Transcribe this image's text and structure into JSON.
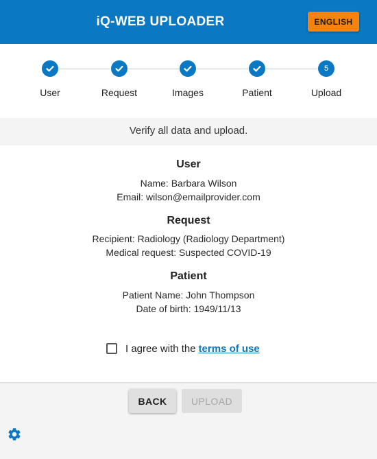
{
  "header": {
    "title": "iQ-WEB UPLOADER",
    "language_button": "ENGLISH"
  },
  "stepper": {
    "steps": [
      {
        "label": "User",
        "state": "completed"
      },
      {
        "label": "Request",
        "state": "completed"
      },
      {
        "label": "Images",
        "state": "completed"
      },
      {
        "label": "Patient",
        "state": "completed"
      },
      {
        "label": "Upload",
        "state": "active",
        "number": "5"
      }
    ]
  },
  "instruction": "Verify all data and upload.",
  "summary": {
    "user": {
      "title": "User",
      "name_line": "Name: Barbara Wilson",
      "email_line": "Email: wilson@emailprovider.com"
    },
    "request": {
      "title": "Request",
      "recipient_line": "Recipient: Radiology (Radiology Department)",
      "medical_request_line": "Medical request: Suspected COVID-19"
    },
    "patient": {
      "title": "Patient",
      "name_line": "Patient Name: John Thompson",
      "dob_line": "Date of birth: 1949/11/13"
    },
    "agree": {
      "text": "I agree with the",
      "link": "terms of use",
      "checked": false
    }
  },
  "actions": {
    "back": "BACK",
    "upload": "UPLOAD"
  },
  "icons": {
    "step_done": "check-icon",
    "settings": "gear-icon"
  },
  "colors": {
    "primary": "#0a78c2",
    "accent": "#f7830f"
  }
}
